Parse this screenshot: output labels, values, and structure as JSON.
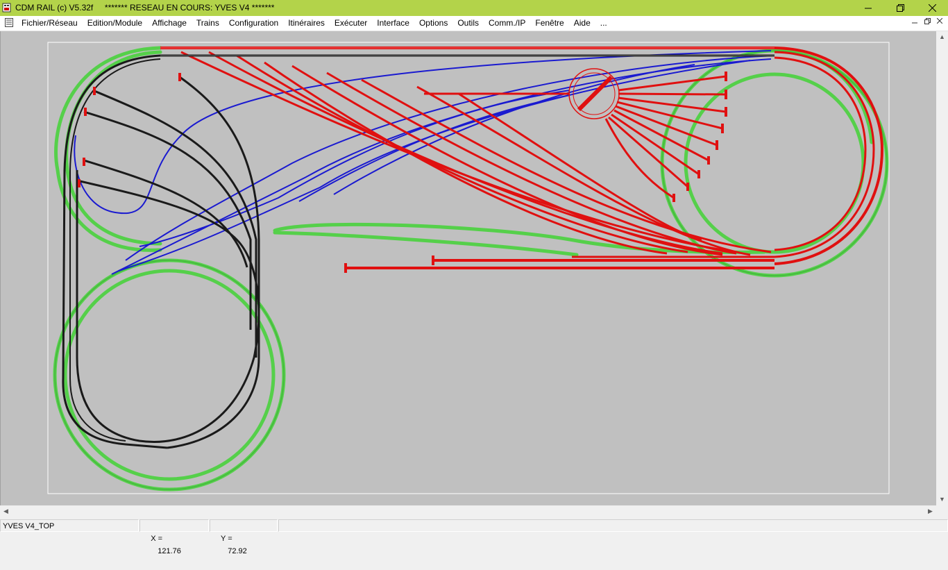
{
  "window": {
    "title": "CDM RAIL (c) V5.32f     ******* RESEAU EN COURS: YVES V4 *******",
    "icons": [
      "app-icon",
      "minimize-icon",
      "restore-icon",
      "close-icon"
    ]
  },
  "menu": {
    "items": [
      "Fichier/Réseau",
      "Edition/Module",
      "Affichage",
      "Trains",
      "Configuration",
      "Itinéraires",
      "Exécuter",
      "Interface",
      "Options",
      "Outils",
      "Comm./IP",
      "Fenêtre",
      "Aide",
      "..."
    ]
  },
  "colors": {
    "track_red": "#e01010",
    "track_blue": "#1a1ad0",
    "track_green": "#55d04a",
    "track_black": "#1a1a1a",
    "canvas_bg": "#c0c0c0",
    "titlebar": "#b3d34a"
  },
  "status": {
    "module": "YVES V4_TOP",
    "x_label": "X =",
    "x_value": "121.76",
    "y_label": "Y =",
    "y_value": "72.92"
  }
}
